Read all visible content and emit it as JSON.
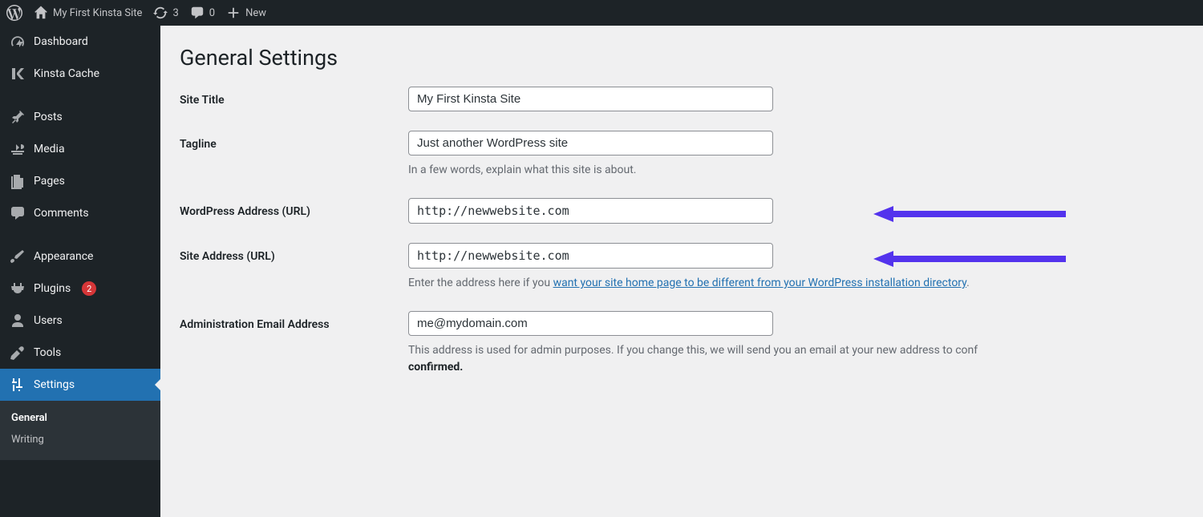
{
  "adminbar": {
    "site_name": "My First Kinsta Site",
    "updates_count": "3",
    "comments_count": "0",
    "new_label": "New"
  },
  "sidebar": {
    "items": {
      "dashboard": "Dashboard",
      "kinsta_cache": "Kinsta Cache",
      "posts": "Posts",
      "media": "Media",
      "pages": "Pages",
      "comments": "Comments",
      "appearance": "Appearance",
      "plugins": "Plugins",
      "plugins_badge": "2",
      "users": "Users",
      "tools": "Tools",
      "settings": "Settings"
    },
    "submenu": {
      "general": "General",
      "writing": "Writing"
    }
  },
  "main": {
    "title": "General Settings",
    "fields": {
      "site_title": {
        "label": "Site Title",
        "value": "My First Kinsta Site"
      },
      "tagline": {
        "label": "Tagline",
        "value": "Just another WordPress site",
        "desc": "In a few words, explain what this site is about."
      },
      "wpurl": {
        "label": "WordPress Address (URL)",
        "value": "http://newwebsite.com"
      },
      "siteurl": {
        "label": "Site Address (URL)",
        "value": "http://newwebsite.com",
        "desc_pre": "Enter the address here if you ",
        "desc_link": "want your site home page to be different from your WordPress installation directory",
        "desc_post": "."
      },
      "admin_email": {
        "label": "Administration Email Address",
        "value": "me@mydomain.com",
        "desc_pre": "This address is used for admin purposes. If you change this, we will send you an email at your new address to conf",
        "desc_strong": "confirmed."
      }
    }
  }
}
